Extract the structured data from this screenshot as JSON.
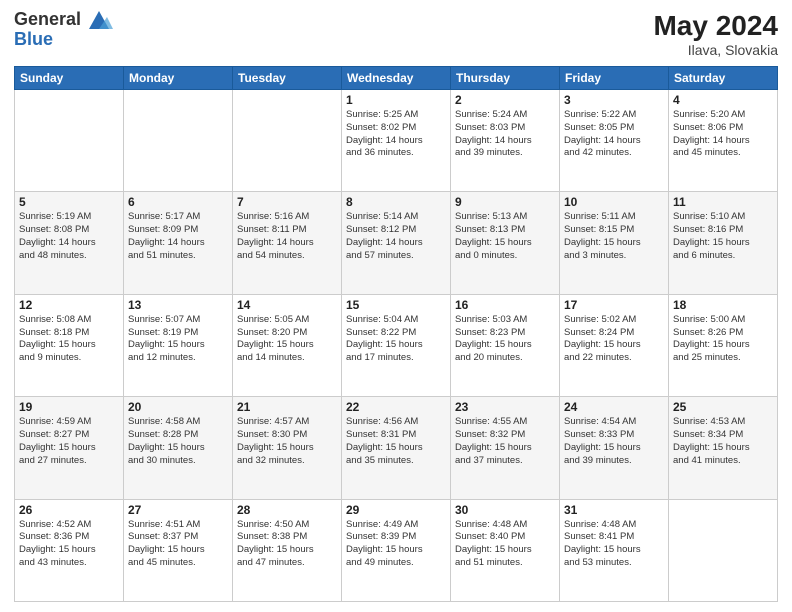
{
  "header": {
    "logo_general": "General",
    "logo_blue": "Blue",
    "month_year": "May 2024",
    "location": "Ilava, Slovakia"
  },
  "days_of_week": [
    "Sunday",
    "Monday",
    "Tuesday",
    "Wednesday",
    "Thursday",
    "Friday",
    "Saturday"
  ],
  "weeks": [
    [
      {
        "day": "",
        "info": ""
      },
      {
        "day": "",
        "info": ""
      },
      {
        "day": "",
        "info": ""
      },
      {
        "day": "1",
        "info": "Sunrise: 5:25 AM\nSunset: 8:02 PM\nDaylight: 14 hours\nand 36 minutes."
      },
      {
        "day": "2",
        "info": "Sunrise: 5:24 AM\nSunset: 8:03 PM\nDaylight: 14 hours\nand 39 minutes."
      },
      {
        "day": "3",
        "info": "Sunrise: 5:22 AM\nSunset: 8:05 PM\nDaylight: 14 hours\nand 42 minutes."
      },
      {
        "day": "4",
        "info": "Sunrise: 5:20 AM\nSunset: 8:06 PM\nDaylight: 14 hours\nand 45 minutes."
      }
    ],
    [
      {
        "day": "5",
        "info": "Sunrise: 5:19 AM\nSunset: 8:08 PM\nDaylight: 14 hours\nand 48 minutes."
      },
      {
        "day": "6",
        "info": "Sunrise: 5:17 AM\nSunset: 8:09 PM\nDaylight: 14 hours\nand 51 minutes."
      },
      {
        "day": "7",
        "info": "Sunrise: 5:16 AM\nSunset: 8:11 PM\nDaylight: 14 hours\nand 54 minutes."
      },
      {
        "day": "8",
        "info": "Sunrise: 5:14 AM\nSunset: 8:12 PM\nDaylight: 14 hours\nand 57 minutes."
      },
      {
        "day": "9",
        "info": "Sunrise: 5:13 AM\nSunset: 8:13 PM\nDaylight: 15 hours\nand 0 minutes."
      },
      {
        "day": "10",
        "info": "Sunrise: 5:11 AM\nSunset: 8:15 PM\nDaylight: 15 hours\nand 3 minutes."
      },
      {
        "day": "11",
        "info": "Sunrise: 5:10 AM\nSunset: 8:16 PM\nDaylight: 15 hours\nand 6 minutes."
      }
    ],
    [
      {
        "day": "12",
        "info": "Sunrise: 5:08 AM\nSunset: 8:18 PM\nDaylight: 15 hours\nand 9 minutes."
      },
      {
        "day": "13",
        "info": "Sunrise: 5:07 AM\nSunset: 8:19 PM\nDaylight: 15 hours\nand 12 minutes."
      },
      {
        "day": "14",
        "info": "Sunrise: 5:05 AM\nSunset: 8:20 PM\nDaylight: 15 hours\nand 14 minutes."
      },
      {
        "day": "15",
        "info": "Sunrise: 5:04 AM\nSunset: 8:22 PM\nDaylight: 15 hours\nand 17 minutes."
      },
      {
        "day": "16",
        "info": "Sunrise: 5:03 AM\nSunset: 8:23 PM\nDaylight: 15 hours\nand 20 minutes."
      },
      {
        "day": "17",
        "info": "Sunrise: 5:02 AM\nSunset: 8:24 PM\nDaylight: 15 hours\nand 22 minutes."
      },
      {
        "day": "18",
        "info": "Sunrise: 5:00 AM\nSunset: 8:26 PM\nDaylight: 15 hours\nand 25 minutes."
      }
    ],
    [
      {
        "day": "19",
        "info": "Sunrise: 4:59 AM\nSunset: 8:27 PM\nDaylight: 15 hours\nand 27 minutes."
      },
      {
        "day": "20",
        "info": "Sunrise: 4:58 AM\nSunset: 8:28 PM\nDaylight: 15 hours\nand 30 minutes."
      },
      {
        "day": "21",
        "info": "Sunrise: 4:57 AM\nSunset: 8:30 PM\nDaylight: 15 hours\nand 32 minutes."
      },
      {
        "day": "22",
        "info": "Sunrise: 4:56 AM\nSunset: 8:31 PM\nDaylight: 15 hours\nand 35 minutes."
      },
      {
        "day": "23",
        "info": "Sunrise: 4:55 AM\nSunset: 8:32 PM\nDaylight: 15 hours\nand 37 minutes."
      },
      {
        "day": "24",
        "info": "Sunrise: 4:54 AM\nSunset: 8:33 PM\nDaylight: 15 hours\nand 39 minutes."
      },
      {
        "day": "25",
        "info": "Sunrise: 4:53 AM\nSunset: 8:34 PM\nDaylight: 15 hours\nand 41 minutes."
      }
    ],
    [
      {
        "day": "26",
        "info": "Sunrise: 4:52 AM\nSunset: 8:36 PM\nDaylight: 15 hours\nand 43 minutes."
      },
      {
        "day": "27",
        "info": "Sunrise: 4:51 AM\nSunset: 8:37 PM\nDaylight: 15 hours\nand 45 minutes."
      },
      {
        "day": "28",
        "info": "Sunrise: 4:50 AM\nSunset: 8:38 PM\nDaylight: 15 hours\nand 47 minutes."
      },
      {
        "day": "29",
        "info": "Sunrise: 4:49 AM\nSunset: 8:39 PM\nDaylight: 15 hours\nand 49 minutes."
      },
      {
        "day": "30",
        "info": "Sunrise: 4:48 AM\nSunset: 8:40 PM\nDaylight: 15 hours\nand 51 minutes."
      },
      {
        "day": "31",
        "info": "Sunrise: 4:48 AM\nSunset: 8:41 PM\nDaylight: 15 hours\nand 53 minutes."
      },
      {
        "day": "",
        "info": ""
      }
    ]
  ]
}
